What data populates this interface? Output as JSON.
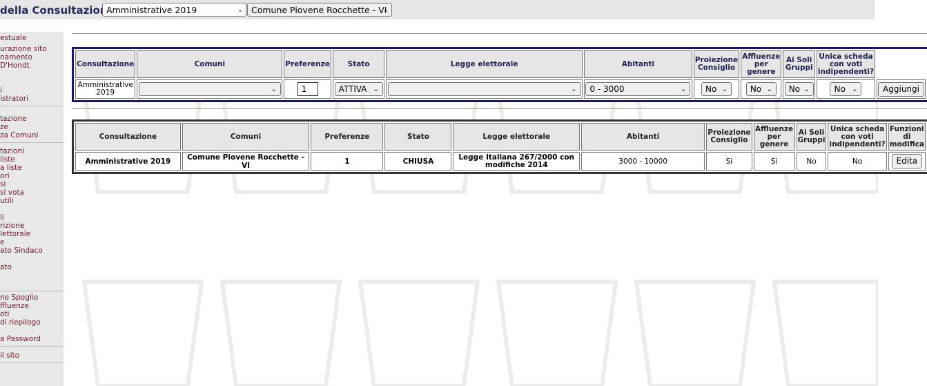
{
  "header": {
    "title": "della Consultazione:",
    "consultazione_value": "Amministrative 2019",
    "comune_value": "Comune Piovene Rocchette - VI"
  },
  "sidebar": {
    "items": [
      "estuale",
      "urazione sito",
      "namento",
      " D'Hondt",
      "i",
      "istratori",
      "tazione",
      "ze",
      "za Comuni",
      "tazioni",
      " liste",
      "a liste",
      "ori",
      "si",
      "si vota",
      " utili",
      "li",
      "rizione",
      "lettorale",
      "e",
      "ato Sindaco",
      "ato",
      "ne Spoglio",
      "ffluenze",
      "oti",
      " di riepilogo",
      "a Password",
      " il sito"
    ]
  },
  "form": {
    "headers": [
      "Consultazione",
      "Comuni",
      "Preferenze",
      "Stato",
      "Legge elettorale",
      "Abitanti",
      "Proiezione Consiglio",
      "Affluenze per genere",
      "Ai Soli Gruppi",
      "Unica scheda con voti indipendenti?"
    ],
    "consultazione": "Amministrative 2019",
    "comuni": "",
    "preferenze": "1",
    "stato": "ATTIVA",
    "legge": "",
    "abitanti": "0 - 3000",
    "proiezione": "No",
    "affluenze": "No",
    "soli_gruppi": "No",
    "unica_scheda": "No",
    "add_label": "Aggiungi"
  },
  "list": {
    "headers": [
      "Consultazione",
      "Comuni",
      "Preferenze",
      "Stato",
      "Legge elettorale",
      "Abitanti",
      "Proiezione Consiglio",
      "Affluenze per genere",
      "Ai Soli Gruppi",
      "Unica scheda con voti indipendenti?",
      "Funzioni di modifica"
    ],
    "rows": [
      {
        "consultazione": "Amministrative 2019",
        "comune": "Comune Piovene Rocchette - VI",
        "preferenze": "1",
        "stato": "CHIUSA",
        "legge": "Legge Italiana 267/2000 con modifiche 2014",
        "abitanti": "3000 - 10000",
        "proiezione": "Si",
        "affluenze": "Si",
        "soli_gruppi": "No",
        "unica_scheda": "No",
        "edit_label": "Edita"
      }
    ]
  },
  "colors": {
    "sidebar_link": "#6e1a2b",
    "form_border": "#1a1a60",
    "header_bg": "#e6e6e6"
  }
}
